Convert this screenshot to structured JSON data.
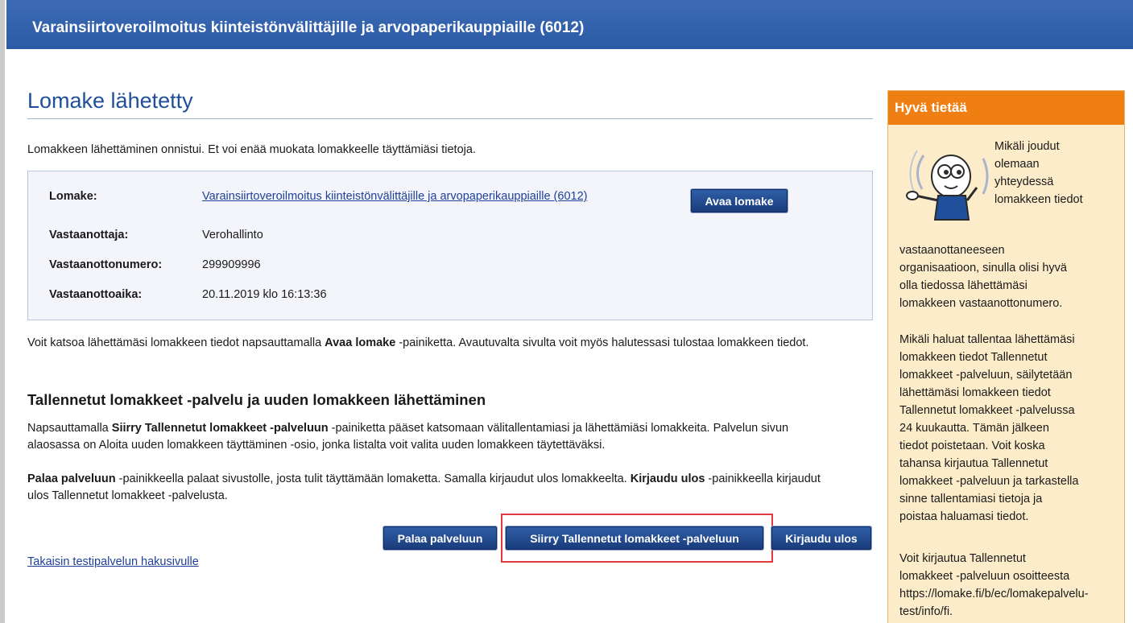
{
  "header": {
    "title": "Varainsiirtoveroilmoitus kiinteistönvälittäjille ja arvopaperikauppiaille (6012)"
  },
  "main": {
    "page_title": "Lomake lähetetty",
    "success_message": "Lomakkeen lähettäminen onnistui. Et voi enää muokata lomakkeelle täyttämiäsi tietoja.",
    "info": {
      "form_label": "Lomake:",
      "form_link": "Varainsiirtoveroilmoitus kiinteistönvälittäjille ja arvopaperikauppiaille (6012)",
      "open_button": "Avaa lomake",
      "recipient_label": "Vastaanottaja:",
      "recipient_value": "Verohallinto",
      "receipt_number_label": "Vastaanottonumero:",
      "receipt_number_value": "299909996",
      "receipt_time_label": "Vastaanottoaika:",
      "receipt_time_value": "20.11.2019 klo 16:13:36"
    },
    "view_paragraph": {
      "before": "Voit katsoa lähettämäsi lomakkeen tiedot napsauttamalla ",
      "bold": "Avaa lomake",
      "after": " -painiketta. Avautuvalta sivulta voit myös halutessasi tulostaa lomakkeen tiedot."
    },
    "section_heading": "Tallennetut lomakkeet -palvelu ja uuden lomakkeen lähettäminen",
    "saved_paragraph": {
      "before": "Napsauttamalla ",
      "bold": "Siirry Tallennetut lomakkeet -palveluun",
      "after": " -painiketta pääset katsomaan välitallentamiasi ja lähettämiäsi lomakkeita. Palvelun sivun alaosassa on Aloita uuden lomakkeen täyttäminen -osio, jonka listalta voit valita uuden lomakkeen täytettäväksi."
    },
    "return_paragraph": {
      "bold1": "Palaa palveluun",
      "middle": " -painikkeella palaat sivustolle, josta tulit täyttämään lomaketta. Samalla kirjaudut ulos lomakkeelta. ",
      "bold2": "Kirjaudu ulos",
      "after": " -painikkeella kirjaudut ulos Tallennetut lomakkeet -palvelusta."
    },
    "buttons": {
      "return": "Palaa palveluun",
      "saved_forms": "Siirry Tallennetut lomakkeet -palveluun",
      "logout": "Kirjaudu ulos"
    },
    "back_link": "Takaisin testipalvelun hakusivulle"
  },
  "sidebar": {
    "title": "Hyvä tietää",
    "intro_lines": [
      "Mikäli joudut",
      "olemaan",
      "yhteydessä",
      "lomakkeen tiedot"
    ],
    "paragraph1_lines": [
      "vastaanottaneeseen",
      "organisaatioon, sinulla olisi hyvä",
      "olla tiedossa lähettämäsi",
      "lomakkeen vastaanottonumero."
    ],
    "paragraph2_lines": [
      "Mikäli haluat tallentaa lähettämäsi",
      "lomakkeen tiedot Tallennetut",
      "lomakkeet -palveluun, säilytetään",
      "lähettämäsi lomakkeen tiedot",
      "Tallennetut lomakkeet -palvelussa",
      "24 kuukautta. Tämän jälkeen",
      "tiedot poistetaan. Voit koska",
      "tahansa kirjautua Tallennetut",
      "lomakkeet -palveluun ja tarkastella",
      "sinne tallentamiasi tietoja ja",
      "poistaa haluamasi tiedot."
    ],
    "paragraph3_lines": [
      "Voit kirjautua Tallennetut",
      "lomakkeet -palveluun osoitteesta",
      "https://lomake.fi/b/ec/lomakepalvelu-",
      "test/info/fi."
    ]
  },
  "colors": {
    "header_blue": "#2b5aa6",
    "title_blue": "#1f4e9a",
    "button_blue": "#1a3c7c",
    "sidebar_orange": "#f07f13",
    "sidebar_bg": "#fcecc9",
    "highlight_red": "#e0393e"
  }
}
